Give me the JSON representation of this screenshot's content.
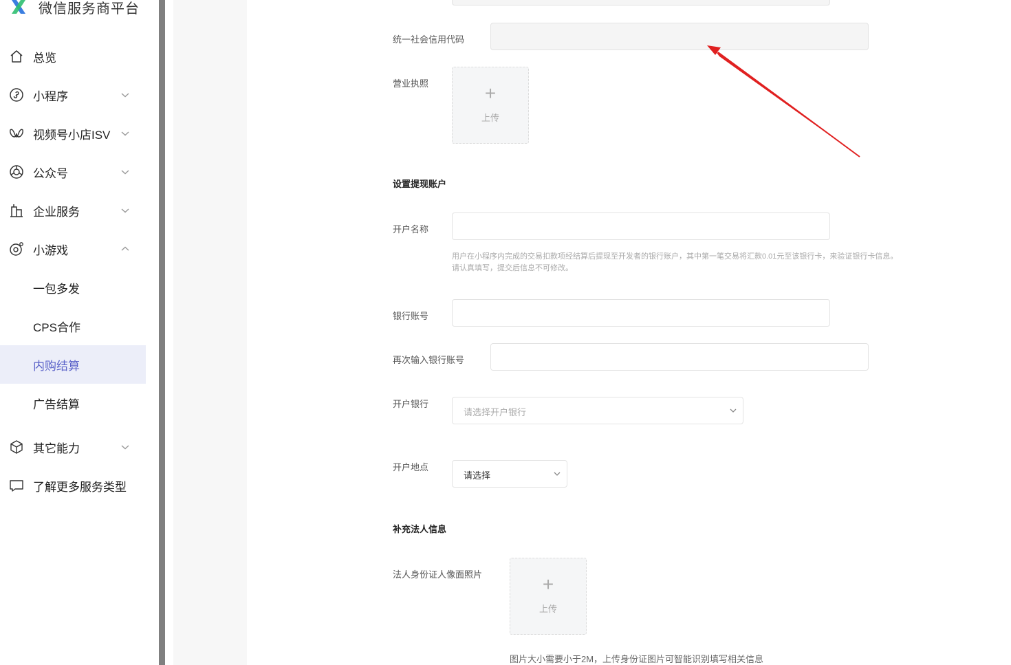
{
  "sidebar": {
    "brand": "微信服务商平台",
    "items": [
      {
        "label": "总览",
        "icon": "home-icon"
      },
      {
        "label": "小程序",
        "icon": "mini-program-icon"
      },
      {
        "label": "视频号小店ISV",
        "icon": "channels-icon"
      },
      {
        "label": "公众号",
        "icon": "official-account-icon"
      },
      {
        "label": "企业服务",
        "icon": "enterprise-icon"
      },
      {
        "label": "小游戏",
        "icon": "mini-game-icon"
      },
      {
        "label": "一包多发"
      },
      {
        "label": "CPS合作"
      },
      {
        "label": "内购结算",
        "active": true
      },
      {
        "label": "广告结算"
      },
      {
        "label": "其它能力",
        "icon": "cube-icon"
      },
      {
        "label": "了解更多服务类型",
        "icon": "chat-icon"
      }
    ]
  },
  "form": {
    "credit_code_label": "统一社会信用代码",
    "business_license_label": "营业执照",
    "upload_text": "上传",
    "withdraw_section": "设置提现账户",
    "account_name_label": "开户名称",
    "account_hint_1": "用户在小程序内完成的交易扣款项经结算后提现至开发者的银行账户，其中第一笔交易将汇款0.01元至该银行卡，来验证银行卡信息。",
    "account_hint_2": "请认真填写，提交后信息不可修改。",
    "bank_account_label": "银行账号",
    "bank_account_repeat_label": "再次输入银行账号",
    "bank_label": "开户银行",
    "bank_placeholder": "请选择开户银行",
    "location_label": "开户地点",
    "location_value": "请选择",
    "legal_section": "补充法人信息",
    "id_photo_label": "法人身份证人像面照片",
    "id_note": "图片大小需要小于2M，上传身份证图片可智能识别填写相关信息"
  },
  "colors": {
    "accent": "#5b63c9",
    "active_bg": "#eceef9",
    "arrow": "#e02020"
  }
}
